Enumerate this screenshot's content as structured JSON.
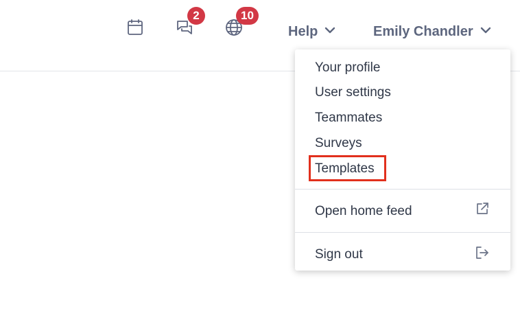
{
  "header": {
    "icons": [
      {
        "name": "calendar-icon"
      },
      {
        "name": "chat-icon",
        "badge": "2"
      },
      {
        "name": "globe-icon",
        "badge": "10"
      }
    ],
    "help_label": "Help",
    "user_label": "Emily Chandler"
  },
  "menu": {
    "items": [
      {
        "label": "Your profile"
      },
      {
        "label": "User settings"
      },
      {
        "label": "Teammates"
      },
      {
        "label": "Surveys"
      },
      {
        "label": "Templates",
        "highlighted": true
      }
    ],
    "open_home_feed": {
      "label": "Open home feed",
      "icon": "external-link-icon"
    },
    "sign_out": {
      "label": "Sign out",
      "icon": "sign-out-icon"
    }
  },
  "colors": {
    "badge": "#d23845",
    "highlight": "#e1301d",
    "nav_text": "#5d667e",
    "menu_text": "#2f3747"
  }
}
